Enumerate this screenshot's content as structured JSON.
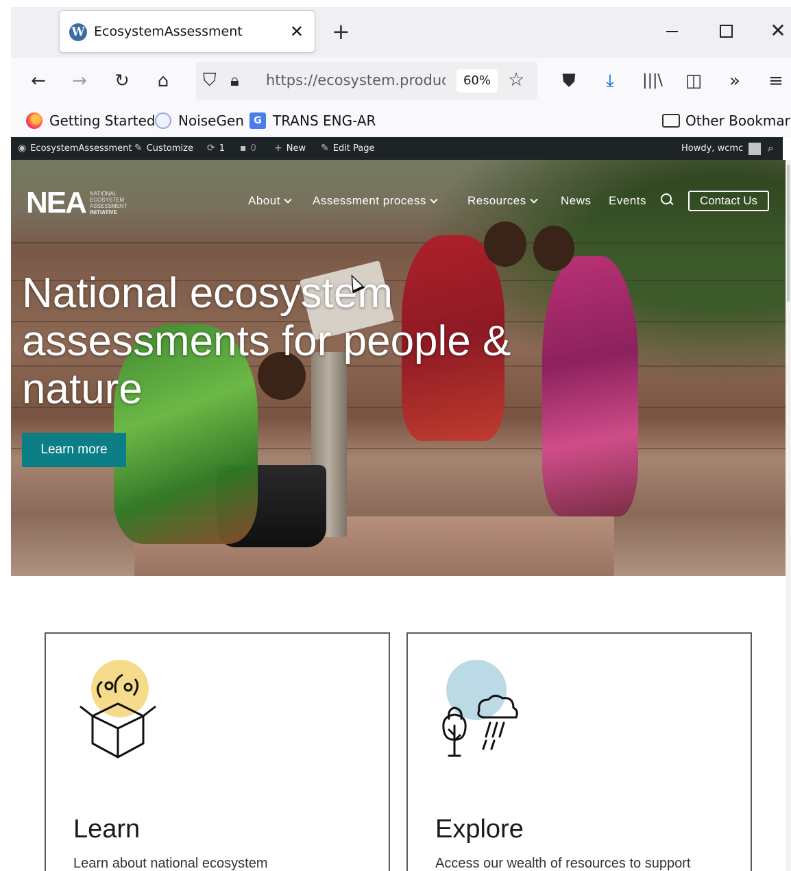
{
  "browser": {
    "tab": {
      "title": "EcosystemAssessment",
      "favicon": "wordpress-icon"
    },
    "address": {
      "url": "https://ecosystem.produc",
      "zoom": "60%"
    },
    "bookmarks": [
      {
        "label": "Getting Started",
        "icon": "firefox-icon"
      },
      {
        "label": "NoiseGen",
        "icon": "noisegen-icon"
      },
      {
        "label": "TRANS ENG-AR",
        "icon": "translate-icon"
      }
    ],
    "other_bookmarks": "Other Bookmarks"
  },
  "wp_admin_bar": {
    "site_name": "EcosystemAssessment",
    "customize": "Customize",
    "updates_count": "1",
    "comments_count": "0",
    "new_label": "New",
    "edit_page": "Edit Page",
    "howdy": "Howdy, wcmc"
  },
  "site": {
    "logo": {
      "mark": "NEA",
      "lines": [
        "NATIONAL",
        "ECOSYSTEM",
        "ASSESSMENT",
        "INITIATIVE"
      ]
    },
    "nav": {
      "about": "About",
      "assessment_process": "Assessment process",
      "resources": "Resources",
      "news": "News",
      "events": "Events",
      "contact": "Contact Us"
    },
    "hero": {
      "title": "National ecosystem assessments for people & nature",
      "cta": "Learn more"
    },
    "cards": [
      {
        "title": "Learn",
        "description": "Learn about national ecosystem",
        "icon": "open-box-icon",
        "icon_bg": "#f6dc8a"
      },
      {
        "title": "Explore",
        "description": "Access our wealth of resources to support",
        "icon": "tree-weather-icon",
        "icon_bg": "#bcd9e6"
      }
    ]
  },
  "colors": {
    "accent_teal": "#0b7f85",
    "admin_bar": "#1d2327"
  }
}
